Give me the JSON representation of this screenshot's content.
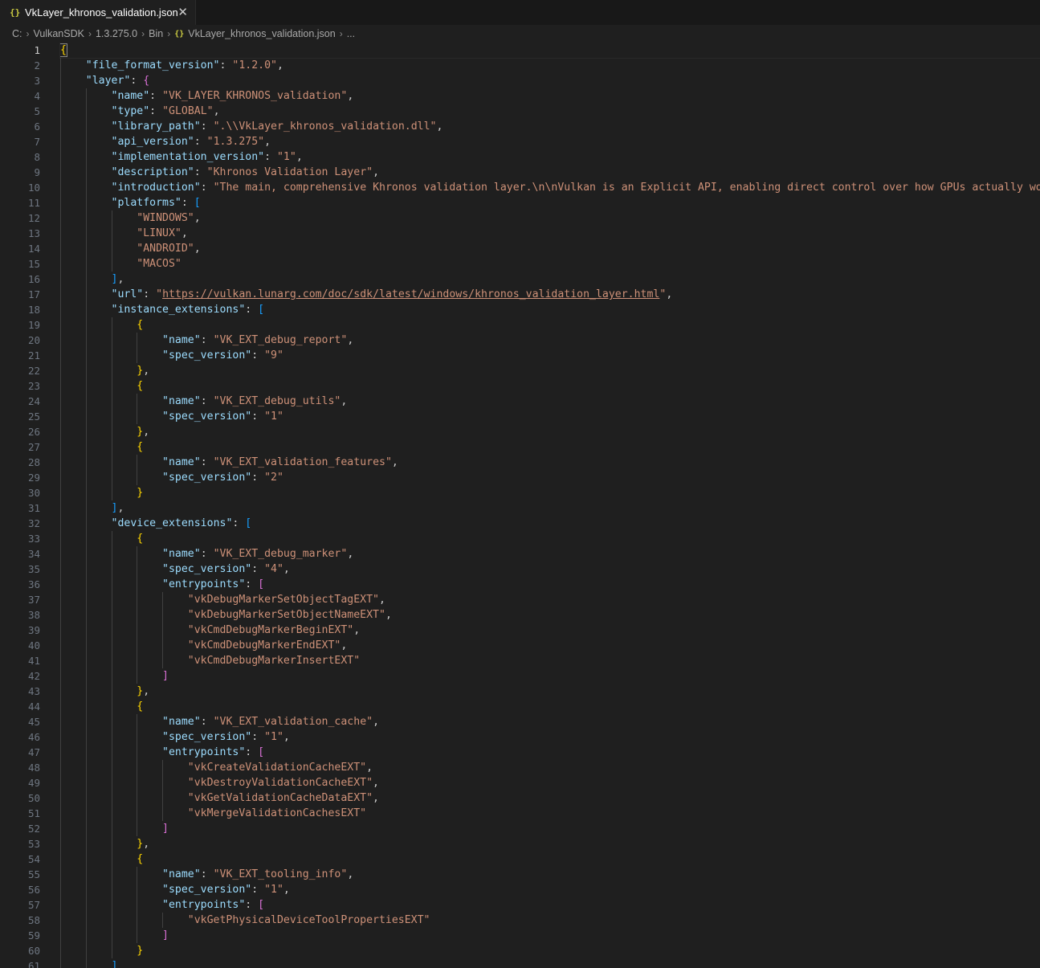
{
  "tab": {
    "label": "VkLayer_khronos_validation.json",
    "file_icon": "{}",
    "close": "✕"
  },
  "breadcrumb": {
    "items": [
      "C:",
      "VulkanSDK",
      "1.3.275.0",
      "Bin"
    ],
    "file_icon": "{}",
    "file": "VkLayer_khronos_validation.json",
    "more": "..."
  },
  "editor": {
    "active_line": 1,
    "lines": [
      {
        "n": "1",
        "indent": 0,
        "toks": [
          [
            "b1",
            "{"
          ]
        ]
      },
      {
        "n": "2",
        "indent": 1,
        "toks": [
          [
            "k",
            "\"file_format_version\""
          ],
          [
            "p",
            ": "
          ],
          [
            "s",
            "\"1.2.0\""
          ],
          [
            "p",
            ","
          ]
        ]
      },
      {
        "n": "3",
        "indent": 1,
        "toks": [
          [
            "k",
            "\"layer\""
          ],
          [
            "p",
            ": "
          ],
          [
            "b2",
            "{"
          ]
        ]
      },
      {
        "n": "4",
        "indent": 2,
        "toks": [
          [
            "k",
            "\"name\""
          ],
          [
            "p",
            ": "
          ],
          [
            "s",
            "\"VK_LAYER_KHRONOS_validation\""
          ],
          [
            "p",
            ","
          ]
        ]
      },
      {
        "n": "5",
        "indent": 2,
        "toks": [
          [
            "k",
            "\"type\""
          ],
          [
            "p",
            ": "
          ],
          [
            "s",
            "\"GLOBAL\""
          ],
          [
            "p",
            ","
          ]
        ]
      },
      {
        "n": "6",
        "indent": 2,
        "toks": [
          [
            "k",
            "\"library_path\""
          ],
          [
            "p",
            ": "
          ],
          [
            "s",
            "\".\\\\VkLayer_khronos_validation.dll\""
          ],
          [
            "p",
            ","
          ]
        ]
      },
      {
        "n": "7",
        "indent": 2,
        "toks": [
          [
            "k",
            "\"api_version\""
          ],
          [
            "p",
            ": "
          ],
          [
            "s",
            "\"1.3.275\""
          ],
          [
            "p",
            ","
          ]
        ]
      },
      {
        "n": "8",
        "indent": 2,
        "toks": [
          [
            "k",
            "\"implementation_version\""
          ],
          [
            "p",
            ": "
          ],
          [
            "s",
            "\"1\""
          ],
          [
            "p",
            ","
          ]
        ]
      },
      {
        "n": "9",
        "indent": 2,
        "toks": [
          [
            "k",
            "\"description\""
          ],
          [
            "p",
            ": "
          ],
          [
            "s",
            "\"Khronos Validation Layer\""
          ],
          [
            "p",
            ","
          ]
        ]
      },
      {
        "n": "10",
        "indent": 2,
        "toks": [
          [
            "k",
            "\"introduction\""
          ],
          [
            "p",
            ": "
          ],
          [
            "s",
            "\"The main, comprehensive Khronos validation layer.\\n\\nVulkan is an Explicit API, enabling direct control over how GPUs actually work. B"
          ]
        ]
      },
      {
        "n": "11",
        "indent": 2,
        "toks": [
          [
            "k",
            "\"platforms\""
          ],
          [
            "p",
            ": "
          ],
          [
            "b3",
            "["
          ]
        ]
      },
      {
        "n": "12",
        "indent": 3,
        "toks": [
          [
            "s",
            "\"WINDOWS\""
          ],
          [
            "p",
            ","
          ]
        ]
      },
      {
        "n": "13",
        "indent": 3,
        "toks": [
          [
            "s",
            "\"LINUX\""
          ],
          [
            "p",
            ","
          ]
        ]
      },
      {
        "n": "14",
        "indent": 3,
        "toks": [
          [
            "s",
            "\"ANDROID\""
          ],
          [
            "p",
            ","
          ]
        ]
      },
      {
        "n": "15",
        "indent": 3,
        "toks": [
          [
            "s",
            "\"MACOS\""
          ]
        ]
      },
      {
        "n": "16",
        "indent": 2,
        "toks": [
          [
            "b3",
            "]"
          ],
          [
            "p",
            ","
          ]
        ]
      },
      {
        "n": "17",
        "indent": 2,
        "toks": [
          [
            "k",
            "\"url\""
          ],
          [
            "p",
            ": "
          ],
          [
            "s",
            "\""
          ],
          [
            "su",
            "https://vulkan.lunarg.com/doc/sdk/latest/windows/khronos_validation_layer.html"
          ],
          [
            "s",
            "\""
          ],
          [
            "p",
            ","
          ]
        ]
      },
      {
        "n": "18",
        "indent": 2,
        "toks": [
          [
            "k",
            "\"instance_extensions\""
          ],
          [
            "p",
            ": "
          ],
          [
            "b3",
            "["
          ]
        ]
      },
      {
        "n": "19",
        "indent": 3,
        "toks": [
          [
            "b1",
            "{"
          ]
        ]
      },
      {
        "n": "20",
        "indent": 4,
        "toks": [
          [
            "k",
            "\"name\""
          ],
          [
            "p",
            ": "
          ],
          [
            "s",
            "\"VK_EXT_debug_report\""
          ],
          [
            "p",
            ","
          ]
        ]
      },
      {
        "n": "21",
        "indent": 4,
        "toks": [
          [
            "k",
            "\"spec_version\""
          ],
          [
            "p",
            ": "
          ],
          [
            "s",
            "\"9\""
          ]
        ]
      },
      {
        "n": "22",
        "indent": 3,
        "toks": [
          [
            "b1",
            "}"
          ],
          [
            "p",
            ","
          ]
        ]
      },
      {
        "n": "23",
        "indent": 3,
        "toks": [
          [
            "b1",
            "{"
          ]
        ]
      },
      {
        "n": "24",
        "indent": 4,
        "toks": [
          [
            "k",
            "\"name\""
          ],
          [
            "p",
            ": "
          ],
          [
            "s",
            "\"VK_EXT_debug_utils\""
          ],
          [
            "p",
            ","
          ]
        ]
      },
      {
        "n": "25",
        "indent": 4,
        "toks": [
          [
            "k",
            "\"spec_version\""
          ],
          [
            "p",
            ": "
          ],
          [
            "s",
            "\"1\""
          ]
        ]
      },
      {
        "n": "26",
        "indent": 3,
        "toks": [
          [
            "b1",
            "}"
          ],
          [
            "p",
            ","
          ]
        ]
      },
      {
        "n": "27",
        "indent": 3,
        "toks": [
          [
            "b1",
            "{"
          ]
        ]
      },
      {
        "n": "28",
        "indent": 4,
        "toks": [
          [
            "k",
            "\"name\""
          ],
          [
            "p",
            ": "
          ],
          [
            "s",
            "\"VK_EXT_validation_features\""
          ],
          [
            "p",
            ","
          ]
        ]
      },
      {
        "n": "29",
        "indent": 4,
        "toks": [
          [
            "k",
            "\"spec_version\""
          ],
          [
            "p",
            ": "
          ],
          [
            "s",
            "\"2\""
          ]
        ]
      },
      {
        "n": "30",
        "indent": 3,
        "toks": [
          [
            "b1",
            "}"
          ]
        ]
      },
      {
        "n": "31",
        "indent": 2,
        "toks": [
          [
            "b3",
            "]"
          ],
          [
            "p",
            ","
          ]
        ]
      },
      {
        "n": "32",
        "indent": 2,
        "toks": [
          [
            "k",
            "\"device_extensions\""
          ],
          [
            "p",
            ": "
          ],
          [
            "b3",
            "["
          ]
        ]
      },
      {
        "n": "33",
        "indent": 3,
        "toks": [
          [
            "b1",
            "{"
          ]
        ]
      },
      {
        "n": "34",
        "indent": 4,
        "toks": [
          [
            "k",
            "\"name\""
          ],
          [
            "p",
            ": "
          ],
          [
            "s",
            "\"VK_EXT_debug_marker\""
          ],
          [
            "p",
            ","
          ]
        ]
      },
      {
        "n": "35",
        "indent": 4,
        "toks": [
          [
            "k",
            "\"spec_version\""
          ],
          [
            "p",
            ": "
          ],
          [
            "s",
            "\"4\""
          ],
          [
            "p",
            ","
          ]
        ]
      },
      {
        "n": "36",
        "indent": 4,
        "toks": [
          [
            "k",
            "\"entrypoints\""
          ],
          [
            "p",
            ": "
          ],
          [
            "b2",
            "["
          ]
        ]
      },
      {
        "n": "37",
        "indent": 5,
        "toks": [
          [
            "s",
            "\"vkDebugMarkerSetObjectTagEXT\""
          ],
          [
            "p",
            ","
          ]
        ]
      },
      {
        "n": "38",
        "indent": 5,
        "toks": [
          [
            "s",
            "\"vkDebugMarkerSetObjectNameEXT\""
          ],
          [
            "p",
            ","
          ]
        ]
      },
      {
        "n": "39",
        "indent": 5,
        "toks": [
          [
            "s",
            "\"vkCmdDebugMarkerBeginEXT\""
          ],
          [
            "p",
            ","
          ]
        ]
      },
      {
        "n": "40",
        "indent": 5,
        "toks": [
          [
            "s",
            "\"vkCmdDebugMarkerEndEXT\""
          ],
          [
            "p",
            ","
          ]
        ]
      },
      {
        "n": "41",
        "indent": 5,
        "toks": [
          [
            "s",
            "\"vkCmdDebugMarkerInsertEXT\""
          ]
        ]
      },
      {
        "n": "42",
        "indent": 4,
        "toks": [
          [
            "b2",
            "]"
          ]
        ]
      },
      {
        "n": "43",
        "indent": 3,
        "toks": [
          [
            "b1",
            "}"
          ],
          [
            "p",
            ","
          ]
        ]
      },
      {
        "n": "44",
        "indent": 3,
        "toks": [
          [
            "b1",
            "{"
          ]
        ]
      },
      {
        "n": "45",
        "indent": 4,
        "toks": [
          [
            "k",
            "\"name\""
          ],
          [
            "p",
            ": "
          ],
          [
            "s",
            "\"VK_EXT_validation_cache\""
          ],
          [
            "p",
            ","
          ]
        ]
      },
      {
        "n": "46",
        "indent": 4,
        "toks": [
          [
            "k",
            "\"spec_version\""
          ],
          [
            "p",
            ": "
          ],
          [
            "s",
            "\"1\""
          ],
          [
            "p",
            ","
          ]
        ]
      },
      {
        "n": "47",
        "indent": 4,
        "toks": [
          [
            "k",
            "\"entrypoints\""
          ],
          [
            "p",
            ": "
          ],
          [
            "b2",
            "["
          ]
        ]
      },
      {
        "n": "48",
        "indent": 5,
        "toks": [
          [
            "s",
            "\"vkCreateValidationCacheEXT\""
          ],
          [
            "p",
            ","
          ]
        ]
      },
      {
        "n": "49",
        "indent": 5,
        "toks": [
          [
            "s",
            "\"vkDestroyValidationCacheEXT\""
          ],
          [
            "p",
            ","
          ]
        ]
      },
      {
        "n": "50",
        "indent": 5,
        "toks": [
          [
            "s",
            "\"vkGetValidationCacheDataEXT\""
          ],
          [
            "p",
            ","
          ]
        ]
      },
      {
        "n": "51",
        "indent": 5,
        "toks": [
          [
            "s",
            "\"vkMergeValidationCachesEXT\""
          ]
        ]
      },
      {
        "n": "52",
        "indent": 4,
        "toks": [
          [
            "b2",
            "]"
          ]
        ]
      },
      {
        "n": "53",
        "indent": 3,
        "toks": [
          [
            "b1",
            "}"
          ],
          [
            "p",
            ","
          ]
        ]
      },
      {
        "n": "54",
        "indent": 3,
        "toks": [
          [
            "b1",
            "{"
          ]
        ]
      },
      {
        "n": "55",
        "indent": 4,
        "toks": [
          [
            "k",
            "\"name\""
          ],
          [
            "p",
            ": "
          ],
          [
            "s",
            "\"VK_EXT_tooling_info\""
          ],
          [
            "p",
            ","
          ]
        ]
      },
      {
        "n": "56",
        "indent": 4,
        "toks": [
          [
            "k",
            "\"spec_version\""
          ],
          [
            "p",
            ": "
          ],
          [
            "s",
            "\"1\""
          ],
          [
            "p",
            ","
          ]
        ]
      },
      {
        "n": "57",
        "indent": 4,
        "toks": [
          [
            "k",
            "\"entrypoints\""
          ],
          [
            "p",
            ": "
          ],
          [
            "b2",
            "["
          ]
        ]
      },
      {
        "n": "58",
        "indent": 5,
        "toks": [
          [
            "s",
            "\"vkGetPhysicalDeviceToolPropertiesEXT\""
          ]
        ]
      },
      {
        "n": "59",
        "indent": 4,
        "toks": [
          [
            "b2",
            "]"
          ]
        ]
      },
      {
        "n": "60",
        "indent": 3,
        "toks": [
          [
            "b1",
            "}"
          ]
        ]
      },
      {
        "n": "61",
        "indent": 2,
        "toks": [
          [
            "b3",
            "]"
          ]
        ]
      }
    ]
  }
}
